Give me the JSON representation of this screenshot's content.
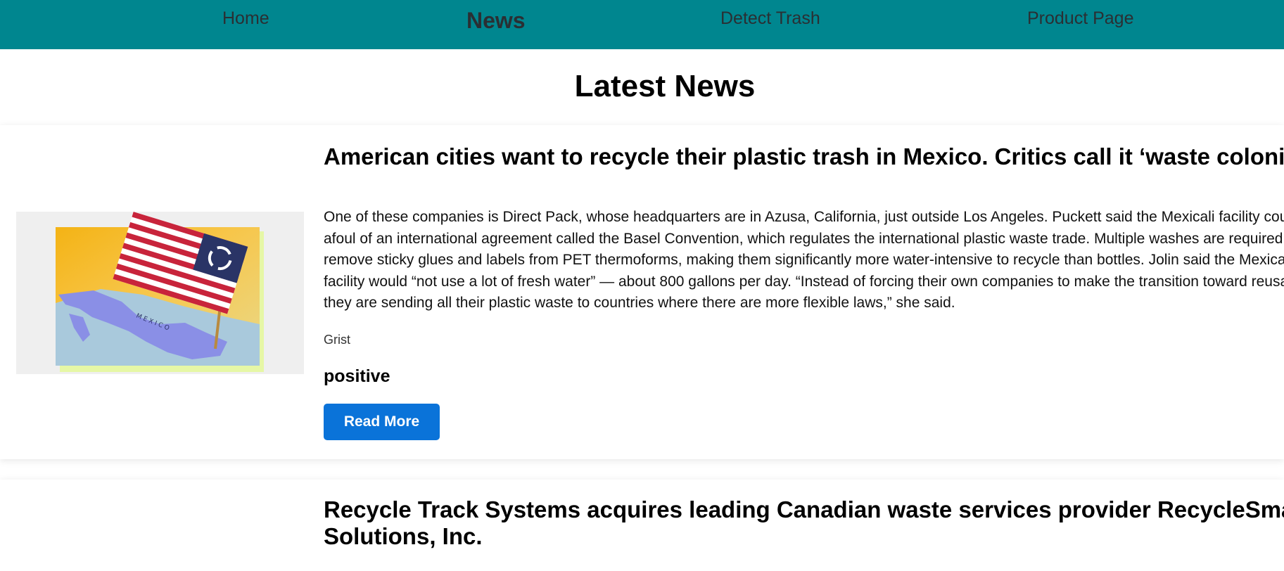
{
  "nav": {
    "items": [
      {
        "label": "Home"
      },
      {
        "label": "News"
      },
      {
        "label": "Detect Trash"
      },
      {
        "label": "Product Page"
      }
    ],
    "active": "News"
  },
  "page": {
    "title": "Latest News"
  },
  "articles": [
    {
      "title": "American cities want to recycle their plastic trash in Mexico. Critics call it ‘waste colonialism.’",
      "body": "One of these companies is Direct Pack, whose headquarters are in Azusa, California, just outside Los Angeles. Puckett said the Mexicali facility could run afoul of an international agreement called the Basel Convention, which regulates the international plastic waste trade. Multiple washes are required to remove sticky glues and labels from PET thermoforms, making them significantly more water-intensive to recycle than bottles. Jolin said the Mexicali facility would “not use a lot of fresh water” — about 800 gallons per day. “Instead of forcing their own companies to make the transition toward reusability, they are sending all their plastic waste to countries where there are more flexible laws,” she said.",
      "source": "Grist",
      "sentiment": "positive",
      "button_label": "Read More",
      "image_icon": "us-flag-on-mexico-map-image"
    },
    {
      "title": "Recycle Track Systems acquires leading Canadian waste services provider RecycleSmart Solutions, Inc."
    }
  ],
  "colors": {
    "navbar_bg": "#00868f",
    "nav_text": "#2a2f33",
    "button_bg": "#0a73d9",
    "button_text": "#ffffff"
  }
}
